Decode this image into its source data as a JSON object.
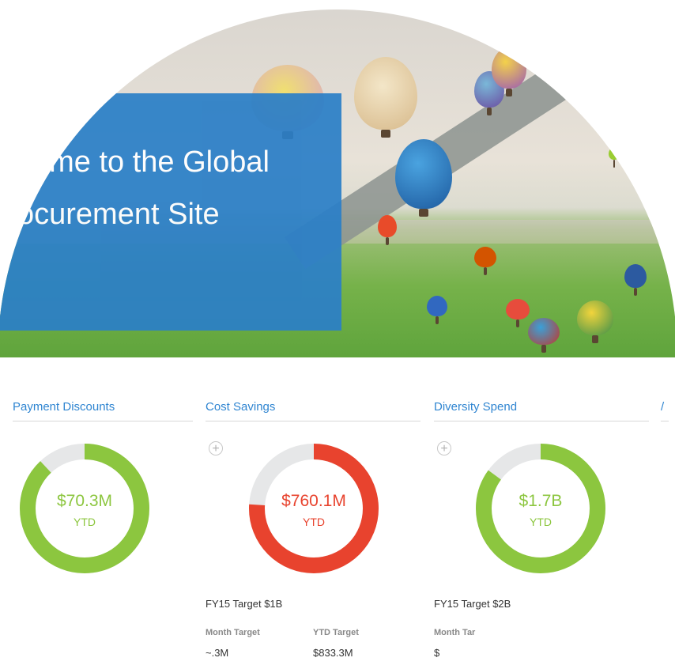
{
  "hero": {
    "title_line1": "come to the Global",
    "title_line2": "ocurement Site",
    "banner_color": "#2b7fc7"
  },
  "cards": [
    {
      "title": "Payment Discounts",
      "value": "$70.3M",
      "value_sub": "YTD",
      "progress": 0.88,
      "color": "#8cc63f"
    },
    {
      "title": "Cost Savings",
      "value": "$760.1M",
      "value_sub": "YTD",
      "progress": 0.76,
      "color": "#e8432e",
      "expand_icon": "plus-circle-icon",
      "target": "FY15 Target $1B",
      "month_target_label": "Month Target",
      "month_target_value": "~.3M",
      "ytd_target_label": "YTD Target",
      "ytd_target_value": "$833.3M"
    },
    {
      "title": "Diversity Spend",
      "value": "$1.7B",
      "value_sub": "YTD",
      "progress": 0.85,
      "color": "#8cc63f",
      "expand_icon": "plus-circle-icon",
      "target": "FY15 Target $2B",
      "month_target_label": "Month Tar",
      "month_target_value": "$"
    },
    {
      "title": "/"
    }
  ],
  "track_color": "#e6e7e8"
}
